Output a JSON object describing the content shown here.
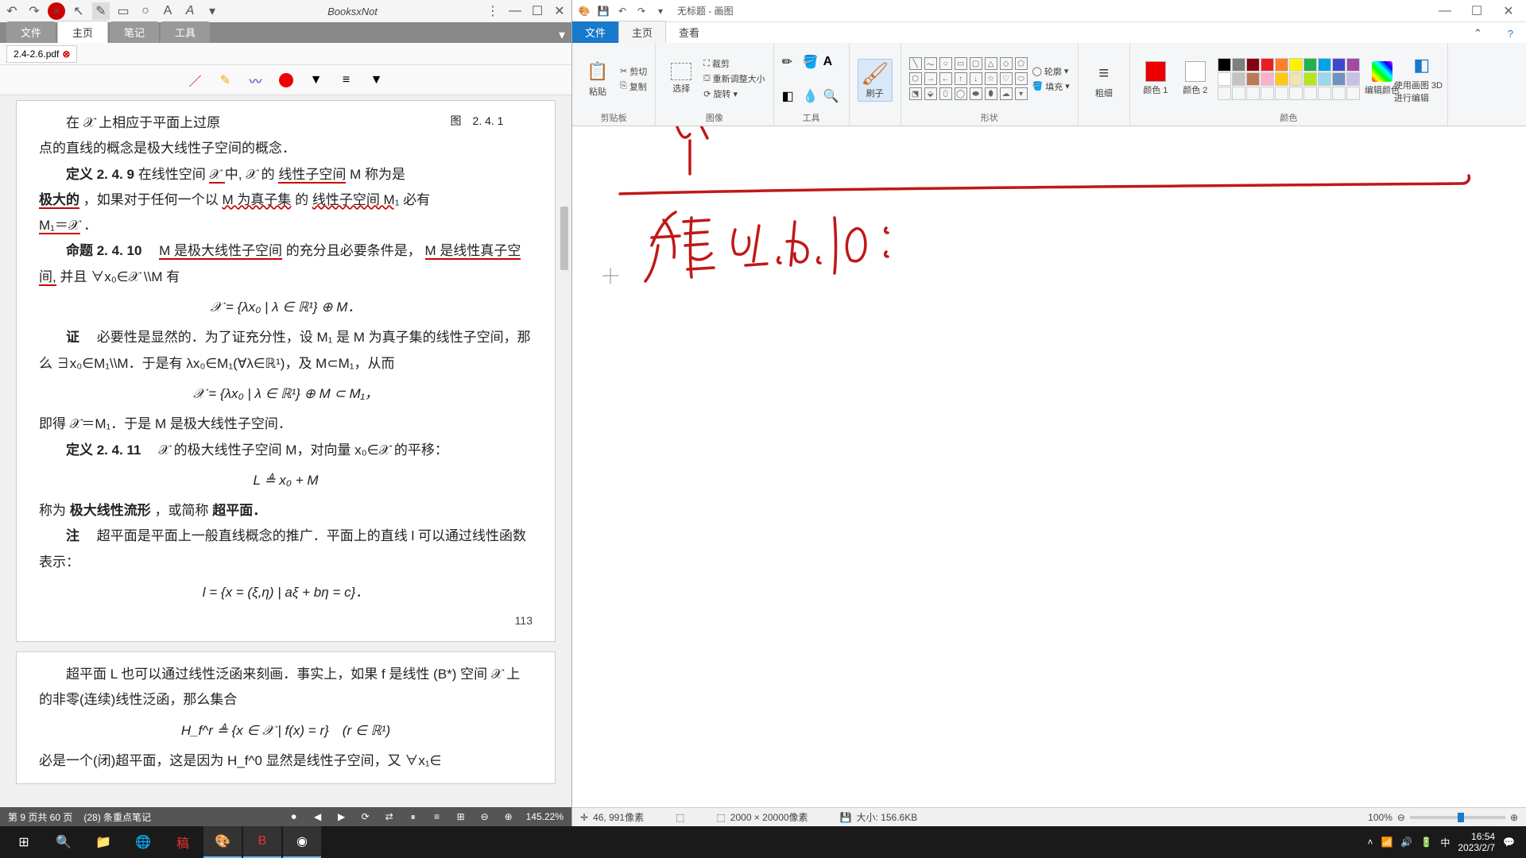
{
  "booksxnote": {
    "title": "BooksxNot",
    "tabs": [
      "文件",
      "主页",
      "笔记",
      "工具"
    ],
    "active_tab": "主页",
    "doc_tab": "2.4-2.6.pdf",
    "status": {
      "page": "第 9 页共 60 页",
      "notes": "(28) 条重点笔记",
      "zoom": "145.22%"
    }
  },
  "pdf": {
    "fig_label": "图　2. 4. 1",
    "l1a": "在 𝒳 上相应于平面上过原",
    "l1b": "点的直线的概念是极大线性子空间的概念．",
    "def249_head": "定义 2. 4. 9",
    "def249_body1": "在线性空间 ",
    "def249_X": "𝒳 ",
    "def249_body2": "中, 𝒳 的",
    "def249_u1": "线性子空间",
    "def249_body3": " M 称为是",
    "def249_bold": "极大的",
    "def249_body4": "，如果对于任何一个以 ",
    "def249_u2": "M 为真子集",
    "def249_body5": "的",
    "def249_u3": "线性子空间 M₁",
    "def249_body6": " 必有 ",
    "def249_eq": "M₁＝𝒳",
    "def249_body7": "．",
    "prop_head": "命题 2. 4. 10",
    "prop_u1": "M 是极大线性子空间",
    "prop_body1": "的充分且必要条件是，",
    "prop_u2": "M 是线性真子空间,",
    "prop_body2": "并且 ∀x₀∈𝒳 \\\\M 有",
    "prop_eq": "𝒳 = {λx₀ | λ ∈ ℝ¹} ⊕ M．",
    "proof_head": "证",
    "proof_l1": "必要性是显然的．为了证充分性，设 M₁ 是 M 为真子集的线性子空间，那么 ∃x₀∈M₁\\\\M．于是有 λx₀∈M₁(∀λ∈ℝ¹)，及 M⊂M₁，从而",
    "proof_eq": "𝒳 = {λx₀ | λ ∈ ℝ¹} ⊕ M ⊂ M₁，",
    "proof_l2": "即得 𝒳＝M₁．于是 M 是极大线性子空间．",
    "def2411_head": "定义 2. 4. 11",
    "def2411_body": "𝒳 的极大线性子空间 M，对向量 x₀∈𝒳 的平移：",
    "def2411_eq": "L ≜ x₀ + M",
    "def2411_l2a": "称为",
    "def2411_bold1": "极大线性流形",
    "def2411_l2b": "，或简称",
    "def2411_bold2": "超平面．",
    "note_head": "注",
    "note_body": "超平面是平面上一般直线概念的推广．平面上的直线 l 可以通过线性函数表示：",
    "note_eq": "l = {x = (ξ,η) | aξ + bη = c}．",
    "page_num": "113",
    "p2_l1": "超平面 L 也可以通过线性泛函来刻画．事实上，如果 f 是线性 (B*) 空间 𝒳 上的非零(连续)线性泛函，那么集合",
    "p2_eq": "H_f^r ≜ {x ∈ 𝒳 | f(x) = r}　(r ∈ ℝ¹)",
    "p2_l2": "必是一个(闭)超平面，这是因为 H_f^0 显然是线性子空间，又 ∀x₁∈"
  },
  "paint": {
    "title": "无标题 - 画图",
    "tabs": {
      "file": "文件",
      "home": "主页",
      "view": "查看"
    },
    "groups": {
      "clipboard": "剪贴板",
      "paste": "粘贴",
      "cut": "剪切",
      "copy": "复制",
      "image": "图像",
      "select": "选择",
      "crop": "裁剪",
      "resize": "重新调整大小",
      "rotate": "旋转",
      "tools": "工具",
      "brushes": "刷子",
      "shapes": "形状",
      "outline": "轮廓",
      "fill": "填充",
      "size": "粗细",
      "colors": "颜色",
      "color1": "颜色 1",
      "color2": "颜色 2",
      "edit_colors": "编辑颜色",
      "paint3d": "使用画图 3D 进行编辑"
    },
    "status": {
      "pos": "46, 991像素",
      "dims": "2000 × 20000像素",
      "size": "大小: 156.6KB",
      "zoom": "100%"
    }
  },
  "taskbar": {
    "time": "16:54",
    "date": "2023/2/7",
    "ime": "中"
  }
}
